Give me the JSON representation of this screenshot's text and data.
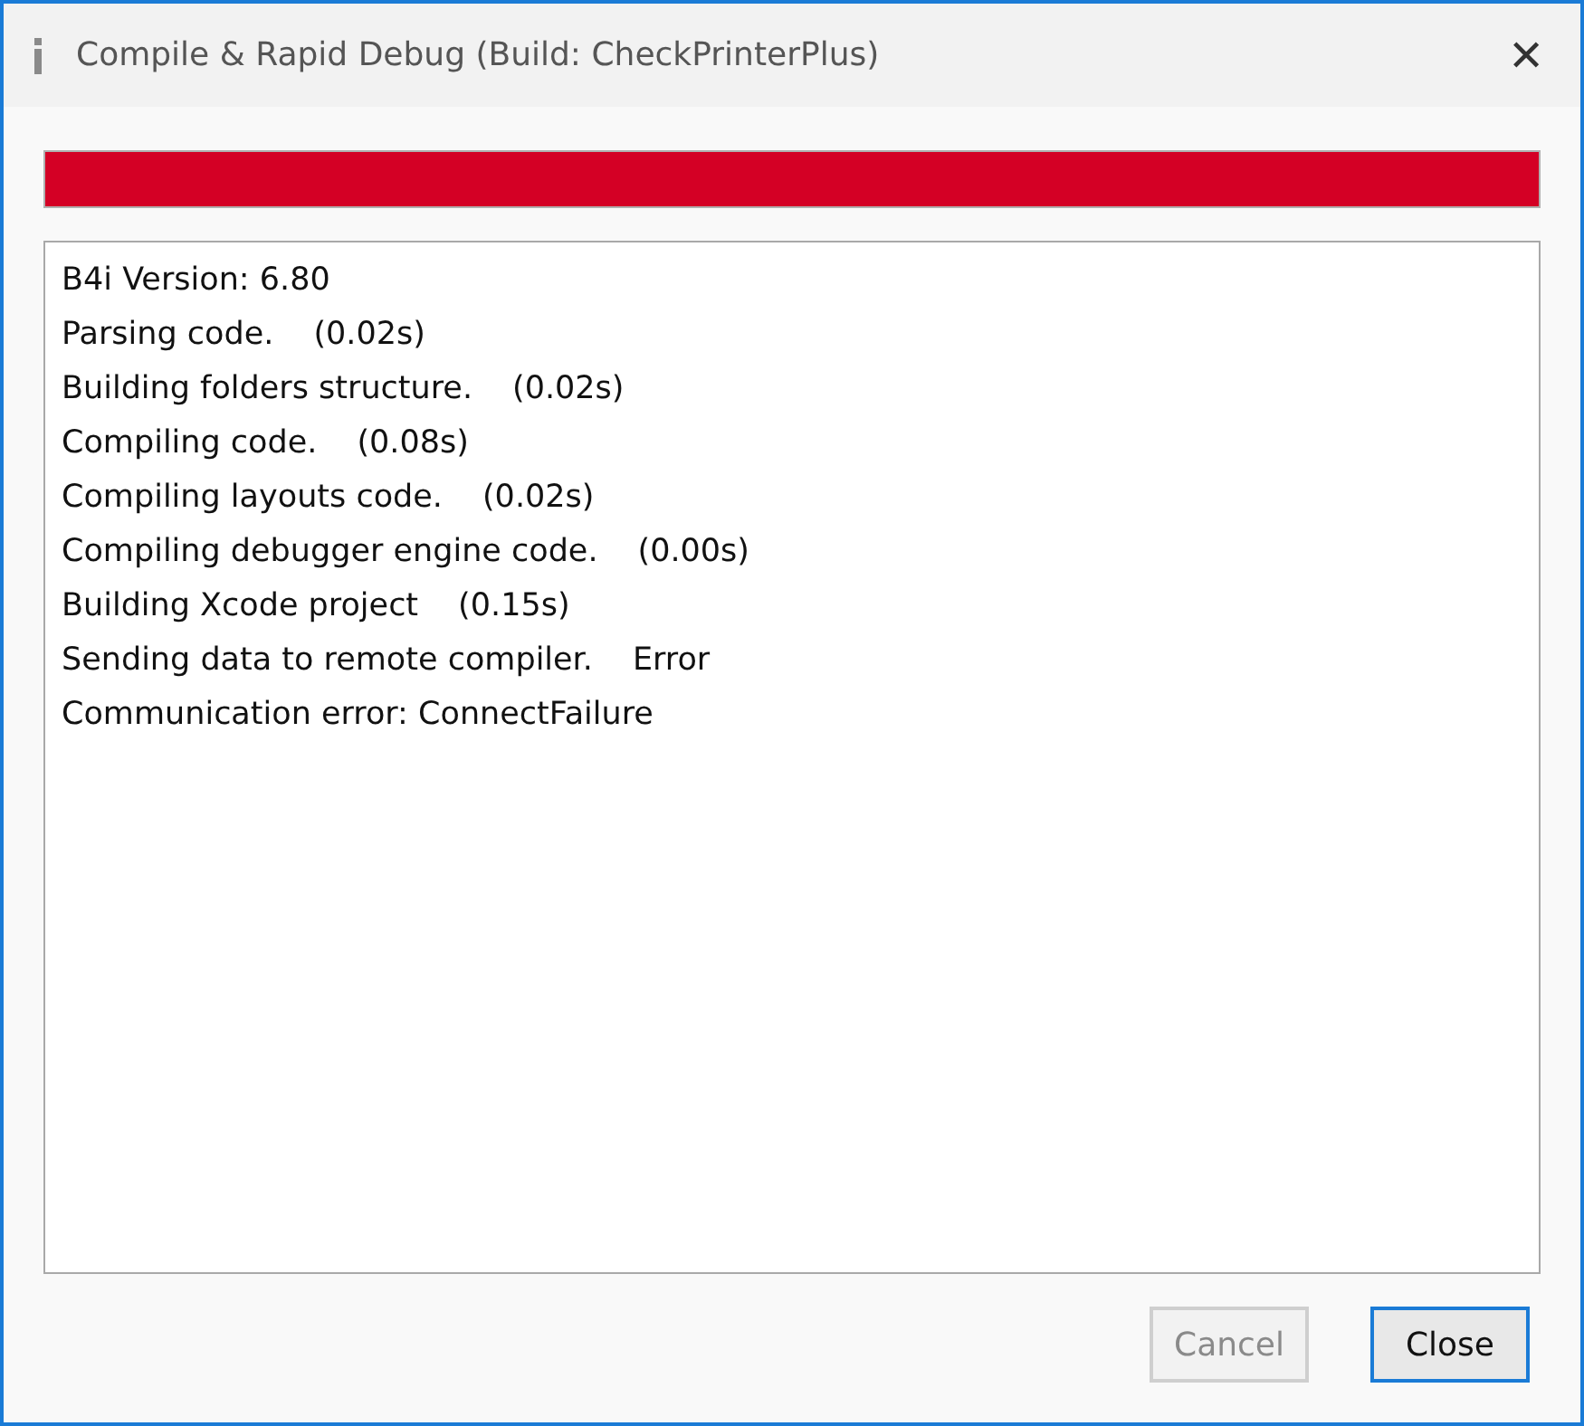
{
  "window": {
    "title": "Compile & Rapid Debug (Build: CheckPrinterPlus)",
    "close_glyph": "✕"
  },
  "progress": {
    "level": 1.0,
    "error": true
  },
  "log": [
    {
      "message": "B4i Version: 6.80"
    },
    {
      "message": "Parsing code.",
      "result": "(0.02s)"
    },
    {
      "message": "Building folders structure.",
      "result": "(0.02s)"
    },
    {
      "message": "Compiling code.",
      "result": "(0.08s)"
    },
    {
      "message": "Compiling layouts code.",
      "result": "(0.02s)"
    },
    {
      "message": "Compiling debugger engine code.",
      "result": "(0.00s)"
    },
    {
      "message": "Building Xcode project",
      "result": "(0.15s)"
    },
    {
      "message": "Sending data to remote compiler.",
      "result": "Error"
    },
    {
      "message": "Communication error: ConnectFailure"
    }
  ],
  "buttons": [
    {
      "label": "Cancel",
      "disabled": true,
      "focused": false
    },
    {
      "label": "Close",
      "disabled": false,
      "focused": true
    }
  ]
}
